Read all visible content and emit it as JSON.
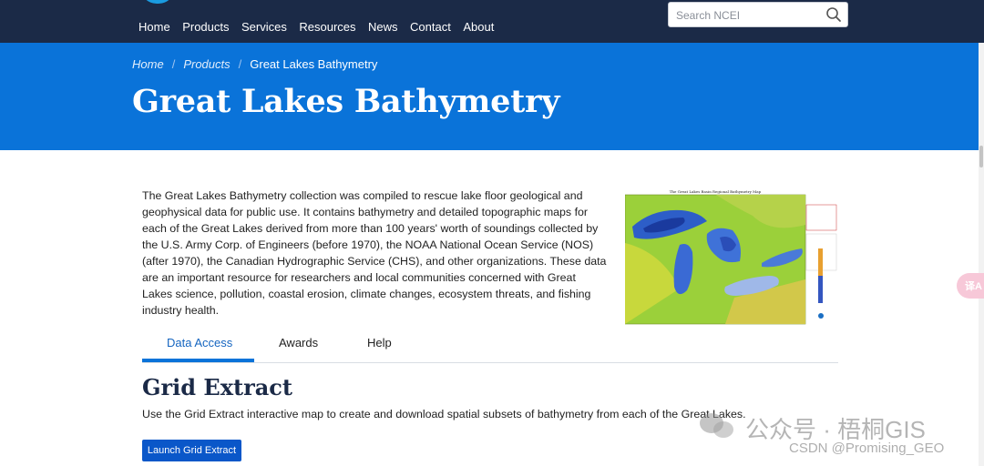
{
  "nav": {
    "items": [
      {
        "label": "Home"
      },
      {
        "label": "Products"
      },
      {
        "label": "Services"
      },
      {
        "label": "Resources"
      },
      {
        "label": "News"
      },
      {
        "label": "Contact"
      },
      {
        "label": "About"
      }
    ],
    "search_placeholder": "Search NCEI"
  },
  "breadcrumb": {
    "items": [
      "Home",
      "Products"
    ],
    "current": "Great Lakes Bathymetry",
    "separator": "/"
  },
  "page": {
    "title": "Great Lakes Bathymetry",
    "intro": "The Great Lakes Bathymetry collection was compiled to rescue lake floor geological and geophysical data for public use. It contains bathymetry and detailed topographic maps for each of the Great Lakes derived from more than 100 years' worth of soundings collected by the U.S. Army Corp. of Engineers (before 1970), the NOAA National Ocean Service (NOS) (after 1970), the Canadian Hydrographic Service (CHS), and other organizations. These data are an important resource for researchers and local communities concerned with Great Lakes science, pollution, coastal erosion, climate changes, ecosystem threats, and fishing industry health.",
    "map_caption": "The Great Lakes Basin Regional Bathymetry Map"
  },
  "tabs": [
    {
      "label": "Data Access",
      "active": true
    },
    {
      "label": "Awards",
      "active": false
    },
    {
      "label": "Help",
      "active": false
    }
  ],
  "section": {
    "title": "Grid Extract",
    "text": "Use the Grid Extract interactive map to create and download spatial subsets of bathymetry from each of the Great Lakes.",
    "button_label": "Launch Grid Extract"
  },
  "watermark": {
    "line1": "公众号 · 梧桐GIS",
    "line2": "CSDN @Promising_GEO"
  },
  "side_widget": {
    "label": "译A"
  },
  "colors": {
    "nav_bg": "#1b2a47",
    "hero_bg": "#0a73d9",
    "button_bg": "#0a57c9",
    "tab_active": "#1565c0"
  }
}
